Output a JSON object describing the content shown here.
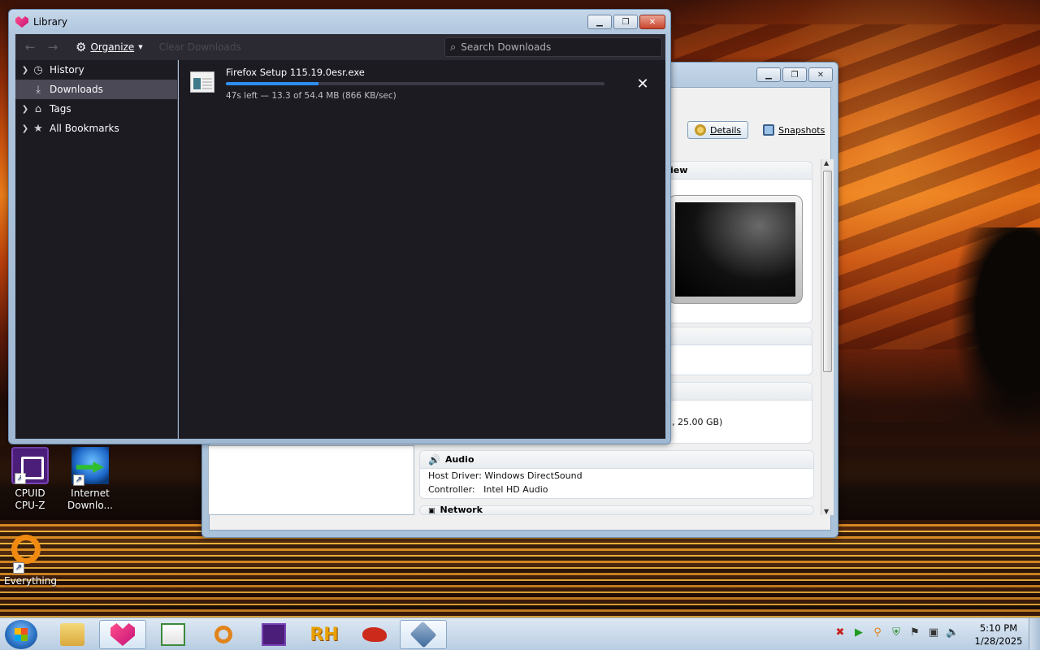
{
  "library": {
    "title": "Library",
    "toolbar": {
      "back_icon": "back-arrow-icon",
      "forward_icon": "forward-arrow-icon",
      "organize_label": "Organize",
      "clear_downloads_label": "Clear Downloads",
      "search_placeholder": "Search Downloads"
    },
    "sidebar": {
      "items": [
        {
          "label": "History",
          "icon": "clock-icon",
          "expandable": true,
          "selected": false
        },
        {
          "label": "Downloads",
          "icon": "download-icon",
          "expandable": false,
          "selected": true
        },
        {
          "label": "Tags",
          "icon": "tag-icon",
          "expandable": true,
          "selected": false
        },
        {
          "label": "All Bookmarks",
          "icon": "star-icon",
          "expandable": true,
          "selected": false
        }
      ]
    },
    "downloads": [
      {
        "filename": "Firefox Setup 115.19.0esr.exe",
        "progress": 0.244,
        "status": "47s left — 13.3 of 54.4 MB (866 KB/sec)"
      }
    ]
  },
  "vbox": {
    "details_label": "Details",
    "snapshots_label": "Snapshots",
    "preview_header": "iew",
    "storage_fragment": ", 25.00 GB)",
    "audio": {
      "title": "Audio",
      "host_driver_label": "Host Driver:",
      "host_driver_value": "Windows DirectSound",
      "controller_label": "Controller:",
      "controller_value": "Intel HD Audio"
    },
    "network_title": "Network"
  },
  "desktop_icons": [
    {
      "label_line1": "CPUID",
      "label_line2": "CPU-Z"
    },
    {
      "label_line1": "Internet",
      "label_line2": "Downlo..."
    },
    {
      "label_line1": "Everything",
      "label_line2": ""
    }
  ],
  "taskbar": {
    "clock_time": "5:10 PM",
    "clock_date": "1/28/2025"
  }
}
